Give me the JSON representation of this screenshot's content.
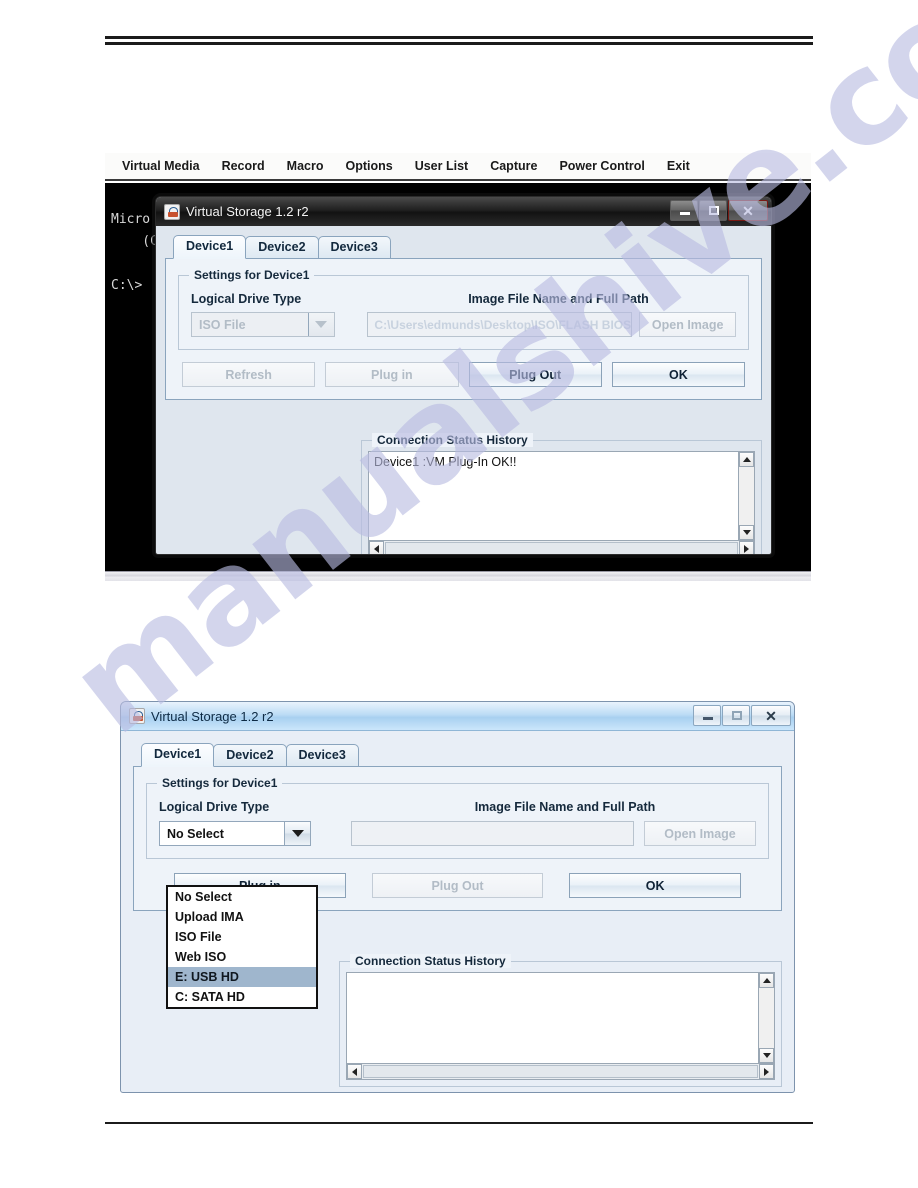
{
  "watermark": {
    "text": "manualshive.com"
  },
  "kvm": {
    "menu_items": [
      "Virtual Media",
      "Record",
      "Macro",
      "Options",
      "User List",
      "Capture",
      "Power Control",
      "Exit"
    ],
    "console_text": "Micro\n    (C\n\nC:\\>"
  },
  "dialog_top": {
    "title": "Virtual Storage 1.2 r2",
    "window_buttons": {
      "minimize": "–",
      "maximize": "□",
      "close": "✕"
    },
    "tabs": [
      {
        "label": "Device1",
        "active": true
      },
      {
        "label": "Device2",
        "active": false
      },
      {
        "label": "Device3",
        "active": false
      }
    ],
    "group_legend": "Settings for Device1",
    "drive_type_label": "Logical Drive Type",
    "image_path_label": "Image File Name and Full Path",
    "drive_type_value": "ISO File",
    "drive_type_disabled": true,
    "image_path_value": "C:\\Users\\edmunds\\Desktop\\ISO\\FLASH BIOS.is",
    "open_image_label": "Open Image",
    "buttons": [
      {
        "label": "Refresh",
        "enabled": false
      },
      {
        "label": "Plug in",
        "enabled": false
      },
      {
        "label": "Plug Out",
        "enabled": true
      },
      {
        "label": "OK",
        "enabled": true
      }
    ],
    "history_legend": "Connection Status History",
    "history_lines": "Device1 :VM Plug-In OK!!"
  },
  "dialog_bottom": {
    "title": "Virtual Storage 1.2 r2",
    "window_buttons": {
      "minimize": "–",
      "maximize": "□",
      "close": "✕"
    },
    "tabs": [
      {
        "label": "Device1",
        "active": true
      },
      {
        "label": "Device2",
        "active": false
      },
      {
        "label": "Device3",
        "active": false
      }
    ],
    "group_legend": "Settings for Device1",
    "drive_type_label": "Logical Drive Type",
    "image_path_label": "Image File Name and Full Path",
    "drive_type_value": "No Select",
    "drive_type_disabled": false,
    "image_path_value": "",
    "open_image_label": "Open Image",
    "dropdown_options": [
      {
        "label": "No Select",
        "selected": false
      },
      {
        "label": "Upload IMA",
        "selected": false
      },
      {
        "label": "ISO File",
        "selected": false
      },
      {
        "label": "Web ISO",
        "selected": false
      },
      {
        "label": "E: USB HD",
        "selected": true
      },
      {
        "label": "C: SATA HD",
        "selected": false
      }
    ],
    "buttons": [
      {
        "label": "Plug in",
        "enabled": true
      },
      {
        "label": "Plug Out",
        "enabled": false
      },
      {
        "label": "OK",
        "enabled": true
      }
    ],
    "history_legend": "Connection Status History",
    "history_lines": ""
  }
}
